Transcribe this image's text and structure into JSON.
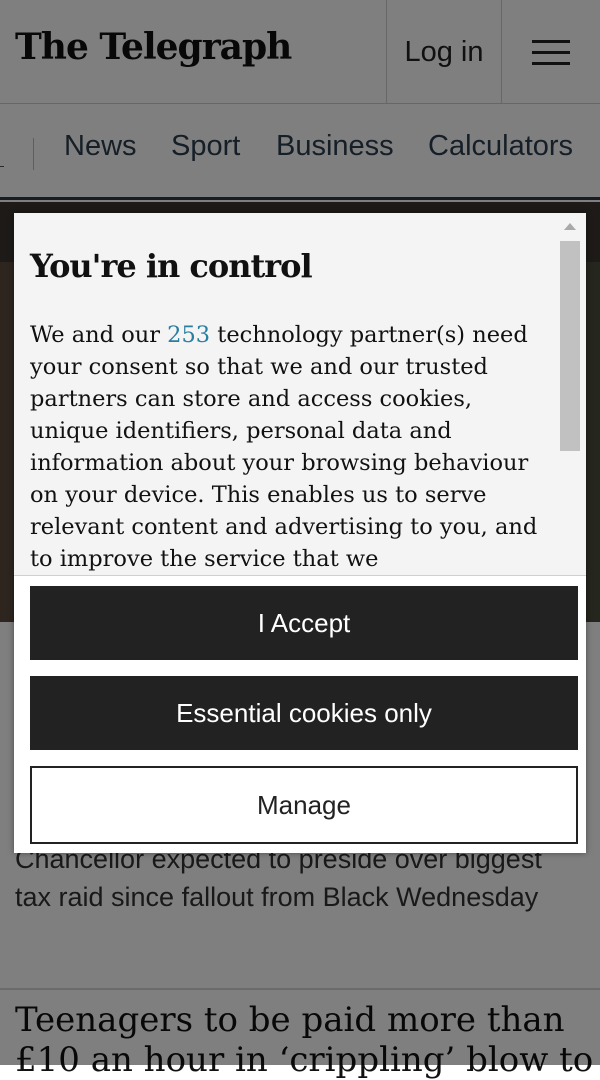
{
  "header": {
    "logo_text": "The Telegraph",
    "login_label": "Log in",
    "menu_icon": "hamburger-icon"
  },
  "nav": {
    "items": [
      {
        "label": "News"
      },
      {
        "label": "Sport"
      },
      {
        "label": "Business"
      },
      {
        "label": "Calculators"
      }
    ]
  },
  "article": {
    "subheading": "Chancellor expected to preside over biggest tax raid since fallout from Black Wednesday",
    "next_headline": "Teenagers to be paid more than £10 an hour in ‘crippling’ blow to"
  },
  "consent": {
    "title": "You're in control",
    "body_prefix": "We and our ",
    "partner_count": "253",
    "body_suffix": " technology partner(s) need your consent so that we and our trusted partners can store and access cookies, unique identifiers, personal data and information about your browsing behaviour on your device. This enables us to serve relevant content and advertising to you, and to improve the service that we",
    "accept_label": "I Accept",
    "essential_label": "Essential cookies only",
    "manage_label": "Manage"
  },
  "colors": {
    "nav_text": "#2c3e4f",
    "nav_rule": "#2b3a46",
    "partner_link": "#2a7fa0",
    "button_dark": "#222222"
  }
}
